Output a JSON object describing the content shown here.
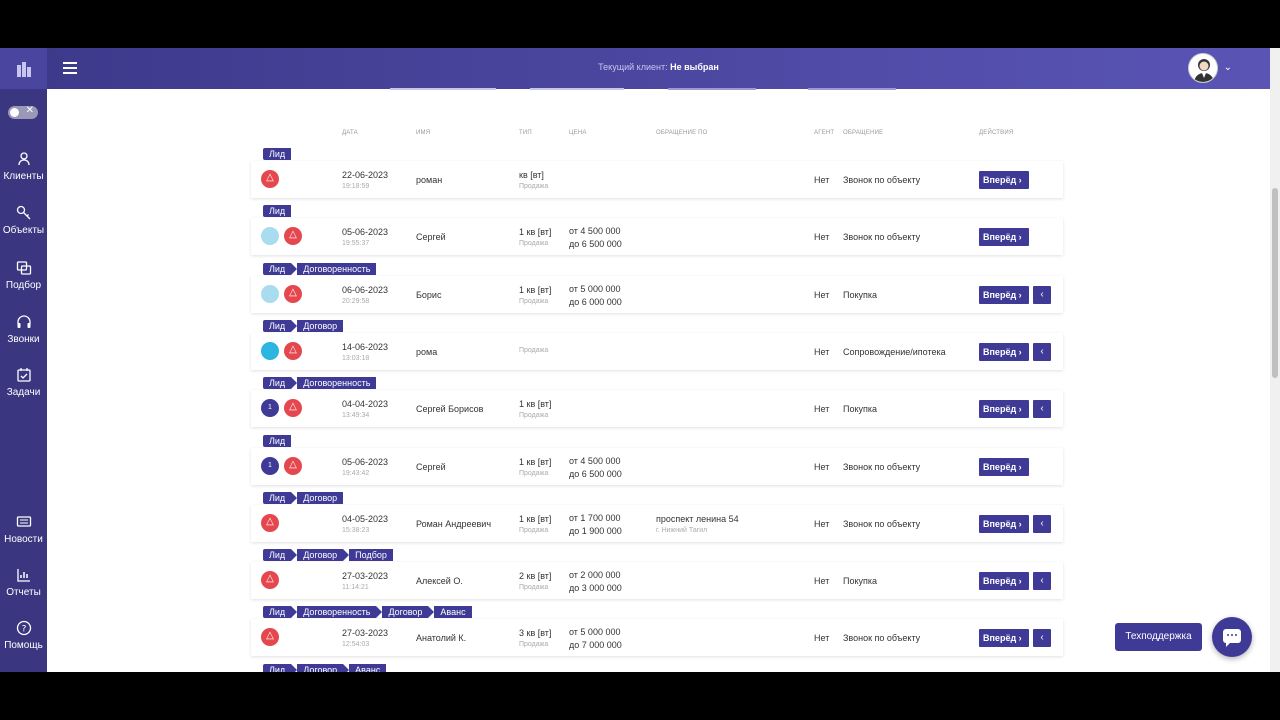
{
  "topbar": {
    "client_label": "Текущий клиент:",
    "client_value": "Не выбран"
  },
  "sidebar": {
    "items": [
      {
        "label": "Клиенты",
        "icon": "user-icon"
      },
      {
        "label": "Объекты",
        "icon": "key-icon"
      },
      {
        "label": "Подбор",
        "icon": "filter-icon"
      },
      {
        "label": "Звонки",
        "icon": "headset-icon"
      },
      {
        "label": "Задачи",
        "icon": "calendar-icon"
      },
      {
        "label": "Новости",
        "icon": "news-icon"
      },
      {
        "label": "Отчеты",
        "icon": "chart-icon"
      },
      {
        "label": "Помощь",
        "icon": "help-icon"
      }
    ]
  },
  "table": {
    "headers": {
      "date": "ДАТА",
      "name": "ИМЯ",
      "type": "ТИП",
      "price": "ЦЕНА",
      "request": "ОБРАЩЕНИЕ ПО",
      "agent": "АГЕНТ",
      "appeal": "ОБРАЩЕНИЕ",
      "actions": "ДЕЙСТВИЯ"
    },
    "forward_label": "Вперёд",
    "rows": [
      {
        "stages": [
          "Лид"
        ],
        "date": "22-06-2023",
        "time": "19:18:59",
        "name": "роман",
        "type": "кв [вт]",
        "type_sub": "Продажа",
        "price_from": "",
        "price_to": "",
        "request": "",
        "request_sub": "",
        "agent": "Нет",
        "appeal": "Звонок по объекту",
        "back": false,
        "dots": [
          "red"
        ]
      },
      {
        "stages": [
          "Лид"
        ],
        "date": "05-06-2023",
        "time": "19:55:37",
        "name": "Сергей",
        "type": "1 кв [вт]",
        "type_sub": "Продажа",
        "price_from": "от 4 500 000",
        "price_to": "до 6 500 000",
        "request": "",
        "request_sub": "",
        "agent": "Нет",
        "appeal": "Звонок по объекту",
        "back": false,
        "dots": [
          "lightblue",
          "red"
        ]
      },
      {
        "stages": [
          "Лид",
          "Договоренность"
        ],
        "date": "06-06-2023",
        "time": "20:29:58",
        "name": "Борис",
        "type": "1 кв [вт]",
        "type_sub": "Продажа",
        "price_from": "от 5 000 000",
        "price_to": "до 6 000 000",
        "request": "",
        "request_sub": "",
        "agent": "Нет",
        "appeal": "Покупка",
        "back": true,
        "dots": [
          "lightblue",
          "red"
        ]
      },
      {
        "stages": [
          "Лид",
          "Договор"
        ],
        "date": "14-06-2023",
        "time": "13:03:18",
        "name": "рома",
        "type": "",
        "type_sub": "Продажа",
        "price_from": "",
        "price_to": "",
        "request": "",
        "request_sub": "",
        "agent": "Нет",
        "appeal": "Сопровождение/ипотека",
        "back": true,
        "dots": [
          "cyan",
          "red"
        ]
      },
      {
        "stages": [
          "Лид",
          "Договоренность"
        ],
        "date": "04-04-2023",
        "time": "13:49:34",
        "name": "Сергей Борисов",
        "type": "1 кв [вт]",
        "type_sub": "Продажа",
        "price_from": "",
        "price_to": "",
        "request": "",
        "request_sub": "",
        "agent": "Нет",
        "appeal": "Покупка",
        "back": true,
        "dots": [
          "num",
          "red"
        ],
        "num": "1"
      },
      {
        "stages": [
          "Лид"
        ],
        "date": "05-06-2023",
        "time": "19:43:42",
        "name": "Сергей",
        "type": "1 кв [вт]",
        "type_sub": "Продажа",
        "price_from": "от 4 500 000",
        "price_to": "до 6 500 000",
        "request": "",
        "request_sub": "",
        "agent": "Нет",
        "appeal": "Звонок по объекту",
        "back": false,
        "dots": [
          "num",
          "red"
        ],
        "num": "1"
      },
      {
        "stages": [
          "Лид",
          "Договор"
        ],
        "date": "04-05-2023",
        "time": "15:38:23",
        "name": "Роман Андреевич",
        "type": "1 кв [вт]",
        "type_sub": "Продажа",
        "price_from": "от 1 700 000",
        "price_to": "до 1 900 000",
        "request": "проспект ленина 54",
        "request_sub": "г. Нижний Тагил",
        "agent": "Нет",
        "appeal": "Звонок по объекту",
        "back": true,
        "dots": [
          "red"
        ]
      },
      {
        "stages": [
          "Лид",
          "Договор",
          "Подбор"
        ],
        "date": "27-03-2023",
        "time": "11:14:21",
        "name": "Алексей О.",
        "type": "2 кв [вт]",
        "type_sub": "Продажа",
        "price_from": "от 2 000 000",
        "price_to": "до 3 000 000",
        "request": "",
        "request_sub": "",
        "agent": "Нет",
        "appeal": "Покупка",
        "back": true,
        "dots": [
          "red"
        ]
      },
      {
        "stages": [
          "Лид",
          "Договоренность",
          "Договор",
          "Аванс"
        ],
        "date": "27-03-2023",
        "time": "12:54:03",
        "name": "Анатолий К.",
        "type": "3 кв [вт]",
        "type_sub": "Продажа",
        "price_from": "от 5 000 000",
        "price_to": "до 7 000 000",
        "request": "",
        "request_sub": "",
        "agent": "Нет",
        "appeal": "Звонок по объекту",
        "back": true,
        "dots": [
          "red"
        ]
      }
    ],
    "trailing_stages": [
      "Лид",
      "Договор",
      "Аванс"
    ]
  },
  "support": {
    "label": "Техподдержка"
  },
  "colors": {
    "accent": "#3f3a96",
    "alert": "#e5474f"
  }
}
